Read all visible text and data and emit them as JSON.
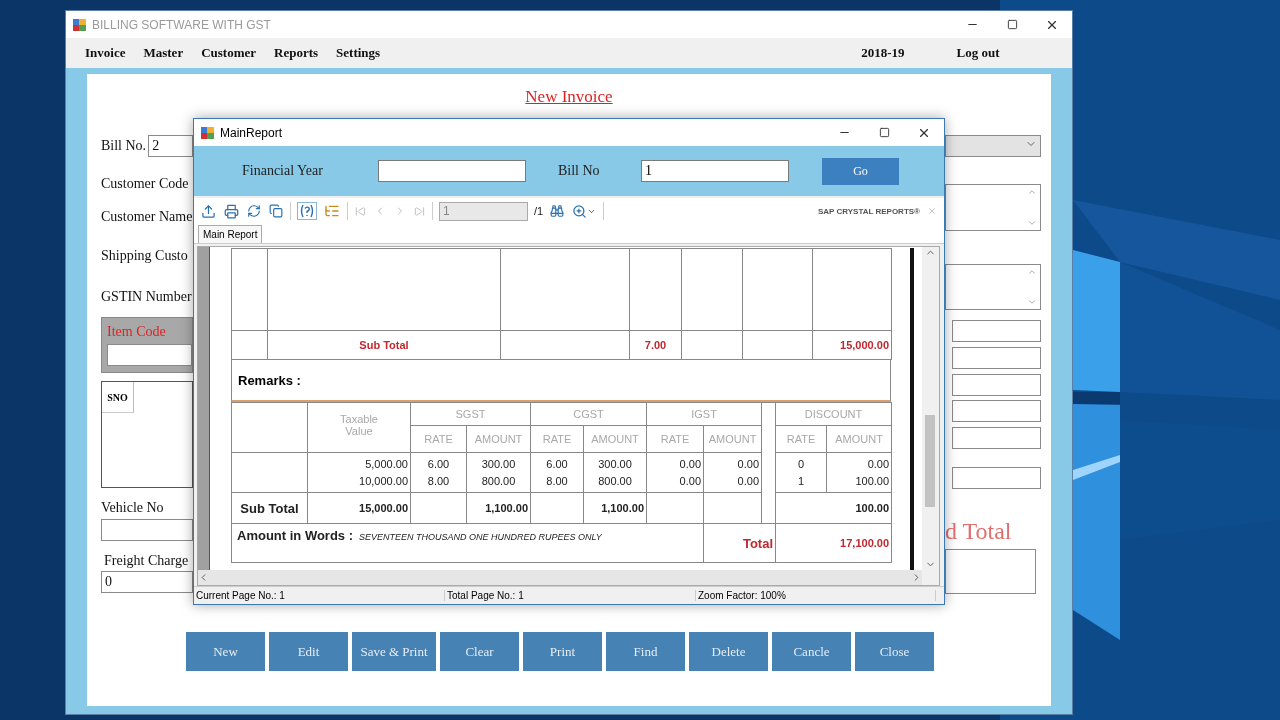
{
  "main_window": {
    "title": "BILLING SOFTWARE WITH GST",
    "menu": [
      "Invoice",
      "Master",
      "Customer",
      "Reports",
      "Settings"
    ],
    "year": "2018-19",
    "logout": "Log out"
  },
  "form": {
    "heading": "New Invoice",
    "bill_no": {
      "label": "Bill No.",
      "value": "2"
    },
    "labels": [
      "Customer Code",
      "Customer Name",
      "Shipping Custo",
      "GSTIN Number"
    ],
    "item_code": "Item Code",
    "grid_columns": [
      "SNO"
    ],
    "vehicle_no": "Vehicle No",
    "freight": {
      "label": "Freight Charge",
      "value": "0"
    },
    "grand_total": "d Total"
  },
  "buttons": [
    "New",
    "Edit",
    "Save & Print",
    "Clear",
    "Print",
    "Find",
    "Delete",
    "Cancle",
    "Close"
  ],
  "report_window": {
    "title": "MainReport",
    "financial_year": "Financial Year",
    "bill_no": {
      "label": "Bill No",
      "value": "1"
    },
    "go": "Go",
    "page": "1",
    "page_count": "/1",
    "brand": "SAP CRYSTAL REPORTS®",
    "tab": "Main Report",
    "items_subtotal": {
      "label": "Sub Total",
      "qty": "7.00",
      "amount": "15,000.00"
    },
    "remarks": "Remarks :",
    "taxable_header": "Taxable Value",
    "groups": [
      {
        "label": "SGST",
        "sub": [
          "RATE",
          "AMOUNT"
        ]
      },
      {
        "label": "CGST",
        "sub": [
          "RATE",
          "AMOUNT"
        ]
      },
      {
        "label": "IGST",
        "sub": [
          "RATE",
          "AMOUNT"
        ]
      },
      {
        "label": "DISCOUNT",
        "sub": [
          "RATE",
          "AMOUNT"
        ]
      }
    ],
    "tax_rows": [
      {
        "taxable": "5,000.00",
        "values": [
          "6.00",
          "300.00",
          "6.00",
          "300.00",
          "0.00",
          "0.00",
          "0",
          "0.00"
        ]
      },
      {
        "taxable": "10,000.00",
        "values": [
          "8.00",
          "800.00",
          "8.00",
          "800.00",
          "0.00",
          "0.00",
          "1",
          "100.00"
        ]
      }
    ],
    "subtotal": {
      "label": "Sub Total",
      "taxable": "15,000.00",
      "sgst_amount": "1,100.00",
      "cgst_amount": "1,100.00",
      "discount": "100.00"
    },
    "words": {
      "label": "Amount in Words :",
      "value": "SEVENTEEN THOUSAND ONE HUNDRED RUPEES ONLY"
    },
    "total": {
      "label": "Total",
      "value": "17,100.00"
    },
    "status": [
      "Current Page No.: 1",
      "Total Page No.: 1",
      "Zoom Factor: 100%"
    ]
  }
}
